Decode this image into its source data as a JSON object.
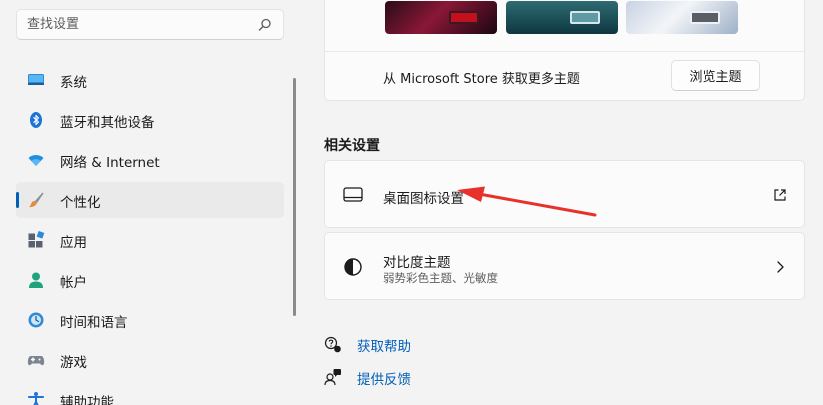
{
  "search": {
    "placeholder": "查找设置"
  },
  "sidebar": {
    "items": [
      {
        "label": "系统",
        "icon": "monitor-icon"
      },
      {
        "label": "蓝牙和其他设备",
        "icon": "bluetooth-icon"
      },
      {
        "label": "网络 & Internet",
        "icon": "wifi-icon"
      },
      {
        "label": "个性化",
        "icon": "brush-icon",
        "active": true
      },
      {
        "label": "应用",
        "icon": "apps-icon"
      },
      {
        "label": "帐户",
        "icon": "person-icon"
      },
      {
        "label": "时间和语言",
        "icon": "globe-clock-icon"
      },
      {
        "label": "游戏",
        "icon": "gamepad-icon"
      },
      {
        "label": "辅助功能",
        "icon": "accessibility-icon"
      }
    ]
  },
  "themes": {
    "store_text": "从 Microsoft Store 获取更多主题",
    "browse_label": "浏览主题"
  },
  "related": {
    "section_title": "相关设置",
    "desktop_icons": {
      "title": "桌面图标设置",
      "icon": "desktop-icon",
      "trail_icon": "external-link-icon"
    },
    "contrast": {
      "title": "对比度主题",
      "subtitle": "弱势彩色主题、光敏度",
      "icon": "contrast-icon",
      "trail_icon": "chevron-right-icon"
    }
  },
  "links": {
    "get_help": "获取帮助",
    "feedback": "提供反馈"
  },
  "colors": {
    "accent": "#005fb8",
    "annotation_arrow": "#e8312b"
  }
}
